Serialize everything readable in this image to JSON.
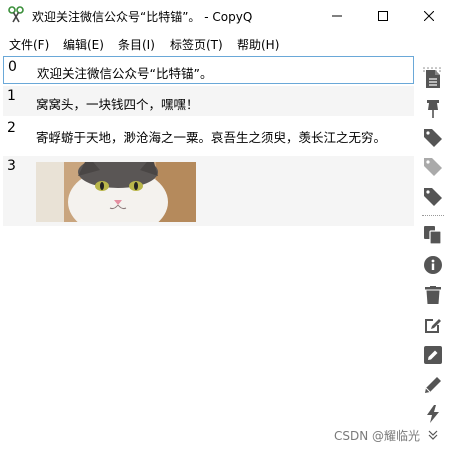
{
  "window": {
    "title": "欢迎关注微信公众号“比特锚”。 - CopyQ",
    "controls": [
      "minimize",
      "maximize",
      "close"
    ]
  },
  "menu": {
    "items": [
      "文件(F)",
      "编辑(E)",
      "条目(I)",
      "标签页(T)",
      "帮助(H)"
    ]
  },
  "items": [
    {
      "index": "0",
      "text": "欢迎关注微信公众号“比特锚”。",
      "selected": true
    },
    {
      "index": "1",
      "text": "窝窝头，一块钱四个，嘿嘿！"
    },
    {
      "index": "2",
      "text": "寄蜉蝣于天地，渺沧海之一粟。哀吾生之须臾，羡长江之无穷。"
    },
    {
      "index": "3",
      "image": "cat-photo"
    }
  ],
  "toolbar": {
    "icons": [
      "show-content-icon",
      "pin-icon",
      "tag-icon",
      "tag-light-icon",
      "tag-dark-icon",
      "copy-icon",
      "info-icon",
      "trash-icon",
      "edit-external-icon",
      "edit-icon",
      "pencil-icon",
      "action-icon",
      "more-chevron-icon"
    ]
  },
  "watermark": "CSDN @耀临光",
  "colors": {
    "icon": "#555555",
    "selection_border": "#6aa8d8",
    "alt_row": "#f5f5f5"
  }
}
